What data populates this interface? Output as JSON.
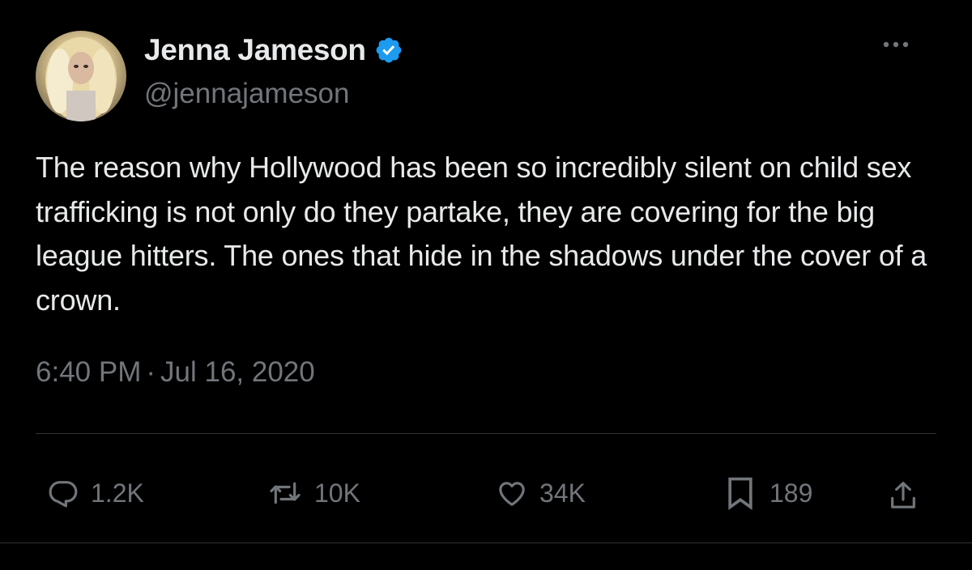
{
  "tweet": {
    "author": {
      "display_name": "Jenna Jameson",
      "handle": "@jennajameson",
      "verified": true
    },
    "text": "The reason why Hollywood has been so incredibly silent on child sex trafficking is not only do they partake, they are covering for the big league hitters. The ones that hide in the shadows under the cover of a crown.",
    "time": "6:40 PM",
    "separator": "·",
    "date": "Jul 16, 2020",
    "metrics": {
      "replies": "1.2K",
      "retweets": "10K",
      "likes": "34K",
      "bookmarks": "189"
    }
  },
  "icons": {
    "verified": "verified-badge-icon",
    "more": "more-horizontal-icon",
    "reply": "reply-icon",
    "retweet": "retweet-icon",
    "like": "heart-icon",
    "bookmark": "bookmark-icon",
    "share": "share-icon"
  },
  "colors": {
    "background": "#000000",
    "primary_text": "#e7e9ea",
    "secondary_text": "#71767b",
    "verified_blue": "#1d9bf0",
    "divider": "#2f3336"
  }
}
